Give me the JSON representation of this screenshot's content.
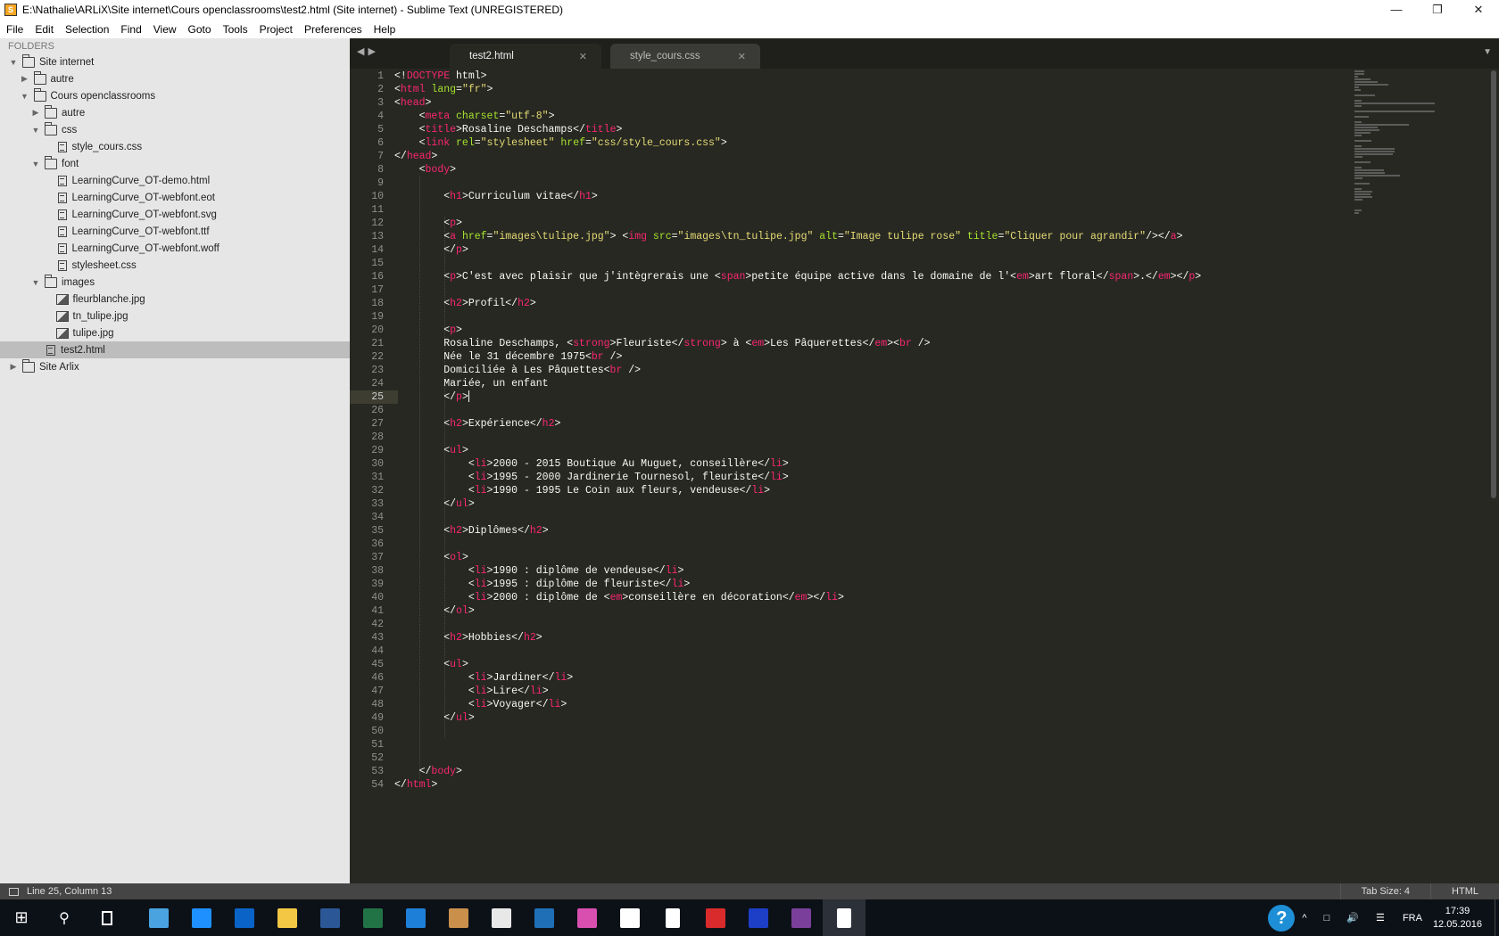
{
  "window": {
    "title": "E:\\Nathalie\\ARLiX\\Site internet\\Cours openclassrooms\\test2.html (Site internet) - Sublime Text (UNREGISTERED)"
  },
  "menu": [
    "File",
    "Edit",
    "Selection",
    "Find",
    "View",
    "Goto",
    "Tools",
    "Project",
    "Preferences",
    "Help"
  ],
  "sidebar": {
    "header": "FOLDERS",
    "items": [
      {
        "label": "Site internet",
        "level": 0,
        "type": "folder",
        "state": "open"
      },
      {
        "label": "autre",
        "level": 1,
        "type": "folder",
        "state": "closed"
      },
      {
        "label": "Cours openclassrooms",
        "level": 1,
        "type": "folder",
        "state": "open"
      },
      {
        "label": "autre",
        "level": 2,
        "type": "folder",
        "state": "closed"
      },
      {
        "label": "css",
        "level": 2,
        "type": "folder",
        "state": "open"
      },
      {
        "label": "style_cours.css",
        "level": 3,
        "type": "file"
      },
      {
        "label": "font",
        "level": 2,
        "type": "folder",
        "state": "open"
      },
      {
        "label": "LearningCurve_OT-demo.html",
        "level": 3,
        "type": "file"
      },
      {
        "label": "LearningCurve_OT-webfont.eot",
        "level": 3,
        "type": "file"
      },
      {
        "label": "LearningCurve_OT-webfont.svg",
        "level": 3,
        "type": "file"
      },
      {
        "label": "LearningCurve_OT-webfont.ttf",
        "level": 3,
        "type": "file"
      },
      {
        "label": "LearningCurve_OT-webfont.woff",
        "level": 3,
        "type": "file"
      },
      {
        "label": "stylesheet.css",
        "level": 3,
        "type": "file"
      },
      {
        "label": "images",
        "level": 2,
        "type": "folder",
        "state": "open"
      },
      {
        "label": "fleurblanche.jpg",
        "level": 3,
        "type": "image"
      },
      {
        "label": "tn_tulipe.jpg",
        "level": 3,
        "type": "image"
      },
      {
        "label": "tulipe.jpg",
        "level": 3,
        "type": "image"
      },
      {
        "label": "test2.html",
        "level": 2,
        "type": "file",
        "selected": true
      },
      {
        "label": "Site Arlix",
        "level": 0,
        "type": "folder",
        "state": "closed"
      }
    ]
  },
  "tabs": [
    {
      "label": "test2.html",
      "active": true
    },
    {
      "label": "style_cours.css",
      "active": false
    }
  ],
  "editor": {
    "current_line": 25,
    "lines": [
      "<!DOCTYPE html>",
      "<html lang=\"fr\">",
      "<head>",
      "    <meta charset=\"utf-8\">",
      "    <title>Rosaline Deschamps</title>",
      "    <link rel=\"stylesheet\" href=\"css/style_cours.css\">",
      "</head>",
      "    <body>",
      "",
      "        <h1>Curriculum vitae</h1>",
      "",
      "        <p>",
      "        <a href=\"images\\tulipe.jpg\"> <img src=\"images\\tn_tulipe.jpg\" alt=\"Image tulipe rose\" title=\"Cliquer pour agrandir\"/></a>",
      "        </p>",
      "",
      "        <p>C'est avec plaisir que j'intègrerais une <span>petite équipe active dans le domaine de l'<em>art floral</span>.</em></p>",
      "",
      "        <h2>Profil</h2>",
      "",
      "        <p>",
      "        Rosaline Deschamps, <strong>Fleuriste</strong> à <em>Les Pâquerettes</em><br />",
      "        Née le 31 décembre 1975<br />",
      "        Domiciliée à Les Pâquettes<br />",
      "        Mariée, un enfant",
      "        </p>",
      "",
      "        <h2>Expérience</h2>",
      "",
      "        <ul>",
      "            <li>2000 - 2015 Boutique Au Muguet, conseillère</li>",
      "            <li>1995 - 2000 Jardinerie Tournesol, fleuriste</li>",
      "            <li>1990 - 1995 Le Coin aux fleurs, vendeuse</li>",
      "        </ul>",
      "",
      "        <h2>Diplômes</h2>",
      "",
      "        <ol>",
      "            <li>1990 : diplôme de vendeuse</li>",
      "            <li>1995 : diplôme de fleuriste</li>",
      "            <li>2000 : diplôme de <em>conseillère en décoration</em></li>",
      "        </ol>",
      "",
      "        <h2>Hobbies</h2>",
      "",
      "        <ul>",
      "            <li>Jardiner</li>",
      "            <li>Lire</li>",
      "            <li>Voyager</li>",
      "        </ul>",
      "",
      "",
      "",
      "    </body>",
      "</html>"
    ]
  },
  "statusbar": {
    "position": "Line 25, Column 13",
    "tab_size": "Tab Size: 4",
    "syntax": "HTML"
  },
  "taskbar": {
    "apps": [
      {
        "name": "control-panel",
        "color": "#4aa3df"
      },
      {
        "name": "internet-explorer",
        "color": "#1e90ff"
      },
      {
        "name": "outlook",
        "color": "#0a64c8"
      },
      {
        "name": "file-explorer",
        "color": "#f3c744"
      },
      {
        "name": "word",
        "color": "#2b5797"
      },
      {
        "name": "excel",
        "color": "#217346"
      },
      {
        "name": "edge",
        "color": "#1e7fd8"
      },
      {
        "name": "paint",
        "color": "#c98f4b"
      },
      {
        "name": "calculator",
        "color": "#e8e8e8"
      },
      {
        "name": "remote-desktop",
        "color": "#1f6fb7"
      },
      {
        "name": "colorful-app",
        "color": "#d84fb0"
      },
      {
        "name": "store",
        "color": "#ffffff"
      },
      {
        "name": "notepad",
        "color": "#ffffff"
      },
      {
        "name": "mp3-app",
        "color": "#d92b2b"
      },
      {
        "name": "flag-app",
        "color": "#1d3fc7"
      },
      {
        "name": "winrar",
        "color": "#7a3f9b"
      },
      {
        "name": "sublime-text",
        "color": "#ffffff"
      }
    ],
    "language": "FRA",
    "time": "17:39",
    "date": "12.05.2016"
  },
  "colors": {
    "editor_bg": "#272822",
    "tag": "#f92672",
    "attr": "#a6e22e",
    "string": "#e6db74",
    "text": "#f8f8f2"
  }
}
